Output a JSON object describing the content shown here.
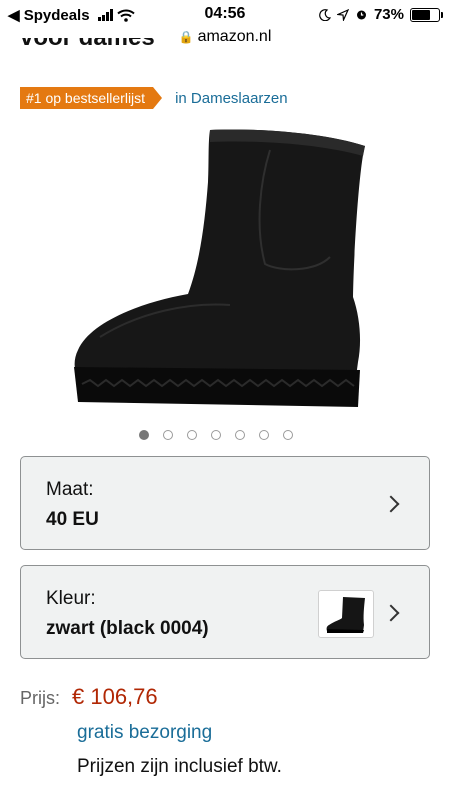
{
  "status_bar": {
    "carrier": "◀ Spydeals",
    "time": "04:56",
    "battery": "73%",
    "battery_level": 0.73
  },
  "browser": {
    "url": "amazon.nl"
  },
  "product": {
    "title_fragment": "voor dames",
    "badge": "#1 op bestsellerlijst",
    "badge_category": "in Dameslaarzen",
    "image_count": 7,
    "active_image_index": 0
  },
  "size_selector": {
    "label": "Maat:",
    "value": "40 EU"
  },
  "color_selector": {
    "label": "Kleur:",
    "value": "zwart (black 0004)"
  },
  "pricing": {
    "label": "Prijs:",
    "price": "€ 106,76",
    "shipping": "gratis bezorging",
    "vat_note": "Prijzen zijn inclusief btw."
  },
  "colors": {
    "badge": "#e47911",
    "link": "#1a6d98",
    "price": "#b12704"
  },
  "icons": [
    "back-arrow-icon",
    "signal-icon",
    "wifi-icon",
    "moon-icon",
    "location-icon",
    "alarm-icon",
    "battery-icon",
    "lock-icon",
    "chevron-right-icon"
  ]
}
